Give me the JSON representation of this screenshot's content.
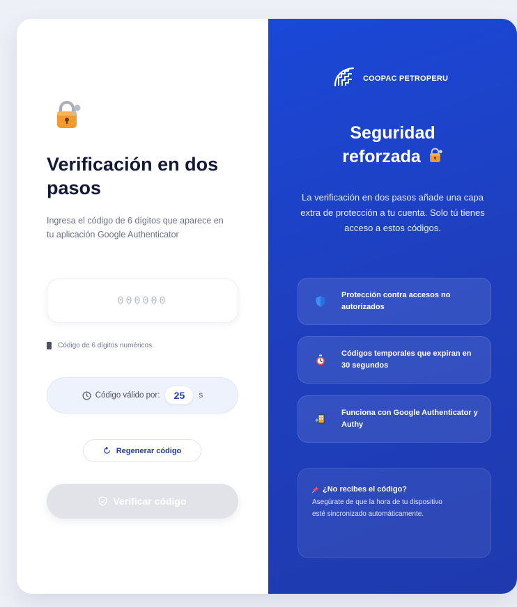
{
  "verification": {
    "title": "Verificación en dos pasos",
    "subtitle": "Ingresa el código de 6 dígitos que aparece en tu aplicación Google Authenticator",
    "code_placeholder": "000000",
    "hint": "Código de 6 dígitos numéricos",
    "timer_label": "Código válido por:",
    "timer_value": "25",
    "timer_unit": "s",
    "regenerate_label": "Regenerar código",
    "verify_label": "Verificar código"
  },
  "promo": {
    "brand_name": "COOPAC PETROPERU",
    "title_line1": "Seguridad",
    "title_line2": "reforzada",
    "description": "La verificación en dos pasos añade una capa extra de protección a tu cuenta. Solo tú tienes acceso a estos códigos.",
    "features": [
      {
        "icon": "shield-icon",
        "text": "Protección contra accesos no autorizados"
      },
      {
        "icon": "stopwatch-icon",
        "text": "Códigos temporales que expiran en 30 segundos"
      },
      {
        "icon": "phone-app-icon",
        "text": "Funciona con Google Authenticator y Authy"
      }
    ],
    "info_title": "¿No recibes el código?",
    "info_body": "Asegúrate de que la hora de tu dispositivo esté sincronizado automáticamente."
  },
  "colors": {
    "accent": "#1f3dbf",
    "panel_blue": "#1e40c8",
    "lock_orange": "#f29a2e"
  }
}
